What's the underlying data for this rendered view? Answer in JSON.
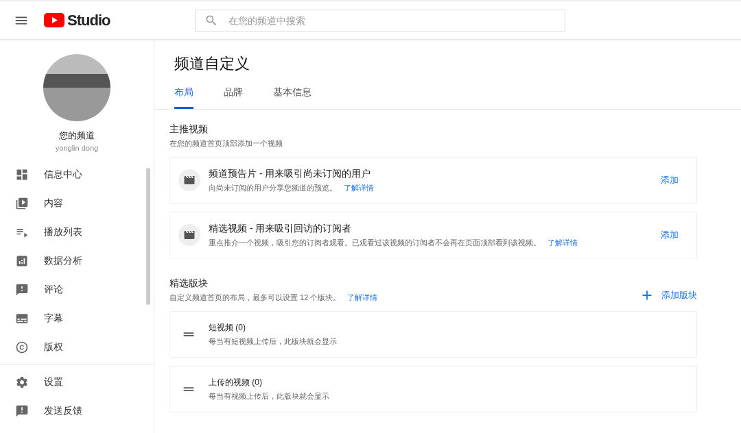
{
  "header": {
    "logo_text": "Studio",
    "search": {
      "placeholder": "在您的频道中搜索"
    }
  },
  "sidebar": {
    "channel_name": "您的频道",
    "user_name": "yonglin dong",
    "items": [
      {
        "label": "信息中心"
      },
      {
        "label": "内容"
      },
      {
        "label": "播放列表"
      },
      {
        "label": "数据分析"
      },
      {
        "label": "评论"
      },
      {
        "label": "字幕"
      },
      {
        "label": "版权"
      }
    ],
    "footer_items": [
      {
        "label": "设置"
      },
      {
        "label": "发送反馈"
      }
    ]
  },
  "page": {
    "title": "频道自定义",
    "tabs": [
      {
        "label": "布局",
        "selected": true
      },
      {
        "label": "品牌",
        "selected": false
      },
      {
        "label": "基本信息",
        "selected": false
      }
    ],
    "featured": {
      "heading": "主推视频",
      "subheading": "在您的频道首页顶部添加一个视频",
      "cards": [
        {
          "title": "频道预告片 - 用来吸引尚未订阅的用户",
          "description": "向尚未订阅的用户分享您频道的预览。",
          "link": "了解详情",
          "action": "添加"
        },
        {
          "title": "精选视频 - 用来吸引回访的订阅者",
          "description": "重点推介一个视频，吸引您的订阅者观看。已观看过该视频的订阅者不会再在页面顶部看到该视频。",
          "link": "了解详情",
          "action": "添加"
        }
      ]
    },
    "sections": {
      "heading": "精选版块",
      "subheading": "自定义频道首页的布局，最多可以设置 12 个版块。",
      "link": "了解详情",
      "add_button": "添加版块",
      "items": [
        {
          "title": "短视频 (0)",
          "description": "每当有短视频上传后，此版块就会显示"
        },
        {
          "title": "上传的视频 (0)",
          "description": "每当有视频上传后，此版块就会显示"
        }
      ]
    }
  }
}
